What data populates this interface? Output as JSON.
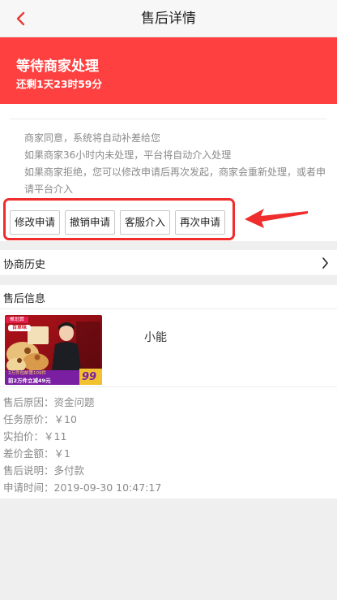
{
  "navbar": {
    "title": "售后详情"
  },
  "status": {
    "title": "等待商家处理",
    "countdown": "还剩1天23时59分"
  },
  "notice": [
    "商家同意，系统将自动补差给您",
    "如果商家36小时内未处理，平台将自动介入处理",
    "如果商家拒绝，您可以修改申请后再次发起，商家会重新处理，或者申",
    "请平台介入"
  ],
  "actions": [
    {
      "label": "修改申请"
    },
    {
      "label": "撤销申请"
    },
    {
      "label": "客服介入"
    },
    {
      "label": "再次申请"
    }
  ],
  "history": {
    "label": "协商历史"
  },
  "aftersale": {
    "section_title": "售后信息",
    "shop_name": "小能",
    "thumb": {
      "brand_small": "聚划算",
      "brand_main": "百草味",
      "promo_line1": "2万件包邮第109件",
      "promo_line2": "前2万件立减49元",
      "promo_right": "99"
    },
    "fields": [
      {
        "label": "售后原因：",
        "value": "资金问题"
      },
      {
        "label": "任务原价：",
        "value": "￥10"
      },
      {
        "label": "实拍价：",
        "value": "￥11"
      },
      {
        "label": "差价金额：",
        "value": "￥1"
      },
      {
        "label": "售后说明：",
        "value": "多付款"
      },
      {
        "label": "申请时间：",
        "value": "2019-09-30 10:47:17"
      }
    ]
  },
  "colors": {
    "accent": "#ff4040",
    "annotation": "#f02d2d"
  }
}
